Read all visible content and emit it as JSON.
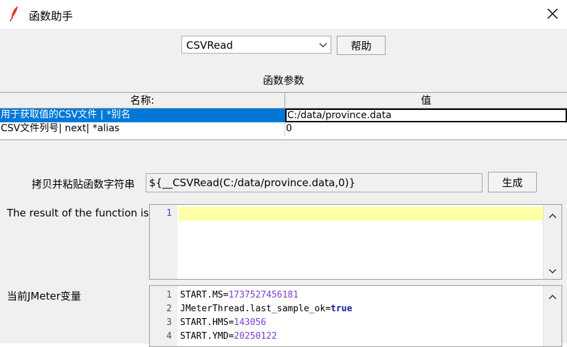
{
  "window": {
    "title": "函数助手",
    "close_icon": "close-icon",
    "app_icon": "feather-icon"
  },
  "function_select": {
    "value": "CSVRead"
  },
  "help_button": {
    "label": "帮助"
  },
  "params": {
    "section_title": "函数参数",
    "columns": [
      "名称:",
      "值"
    ],
    "rows": [
      {
        "name": "用于获取值的CSV文件 | *别名",
        "value": "C:/data/province.data",
        "selected": true
      },
      {
        "name": "CSV文件列号| next| *alias",
        "value": "0",
        "selected": false
      }
    ]
  },
  "copy_paste": {
    "label": "拷贝并粘贴函数字符串",
    "value": "${__CSVRead(C:/data/province.data,0)}"
  },
  "generate_button": {
    "label": "生成"
  },
  "result": {
    "label": "The result of the function is",
    "lines": [
      {
        "num": "1",
        "text": ""
      }
    ]
  },
  "variables": {
    "label": "当前JMeter变量",
    "lines": [
      {
        "num": "1",
        "key": "START.MS=",
        "value": "1737527456181",
        "kind": "number"
      },
      {
        "num": "2",
        "key": "JMeterThread.last_sample_ok=",
        "value": "true",
        "kind": "keyword"
      },
      {
        "num": "3",
        "key": "START.HMS=",
        "value": "143056",
        "kind": "number"
      },
      {
        "num": "4",
        "key": "START.YMD=",
        "value": "20250122",
        "kind": "number"
      }
    ]
  },
  "colors": {
    "selection": "#0078d7",
    "highlight_line": "#ffffa8",
    "number": "#7a3fd1",
    "keyword": "#1a1aa6"
  }
}
